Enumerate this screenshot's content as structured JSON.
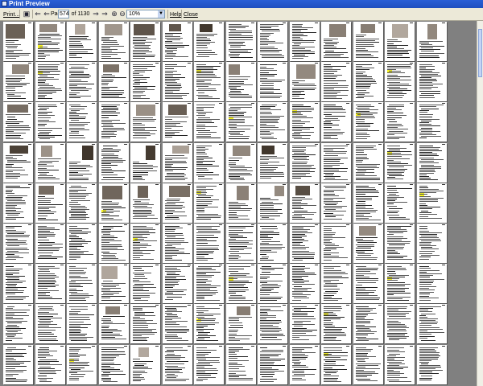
{
  "window": {
    "title": "Print Preview"
  },
  "toolbar": {
    "print_label": "Print...",
    "page_label": "Page",
    "page_value": "574",
    "page_total": "of 1130",
    "zoom_value": "10%",
    "help_label": "Help",
    "close_label": "Close"
  },
  "preview": {
    "columns": 15,
    "rows": 9,
    "photo_pages": [
      1,
      2,
      3,
      4,
      5,
      6,
      7,
      11,
      12,
      13,
      14,
      15,
      16,
      19,
      23,
      25,
      31,
      35,
      36,
      46,
      47,
      48,
      50,
      51,
      53,
      54,
      62,
      64,
      65,
      66,
      68,
      69,
      70,
      87,
      94,
      109,
      113,
      125
    ],
    "highlight_pages": [
      2,
      17,
      22,
      28,
      38,
      40,
      42,
      58,
      64,
      67,
      74,
      80,
      98,
      103,
      112,
      116,
      123,
      131
    ]
  },
  "colors": {
    "titlebar": "#1f4fbf",
    "toolbar": "#ece9d8",
    "workspace": "#808080",
    "page": "#ffffff",
    "highlight": "#f3f020"
  }
}
